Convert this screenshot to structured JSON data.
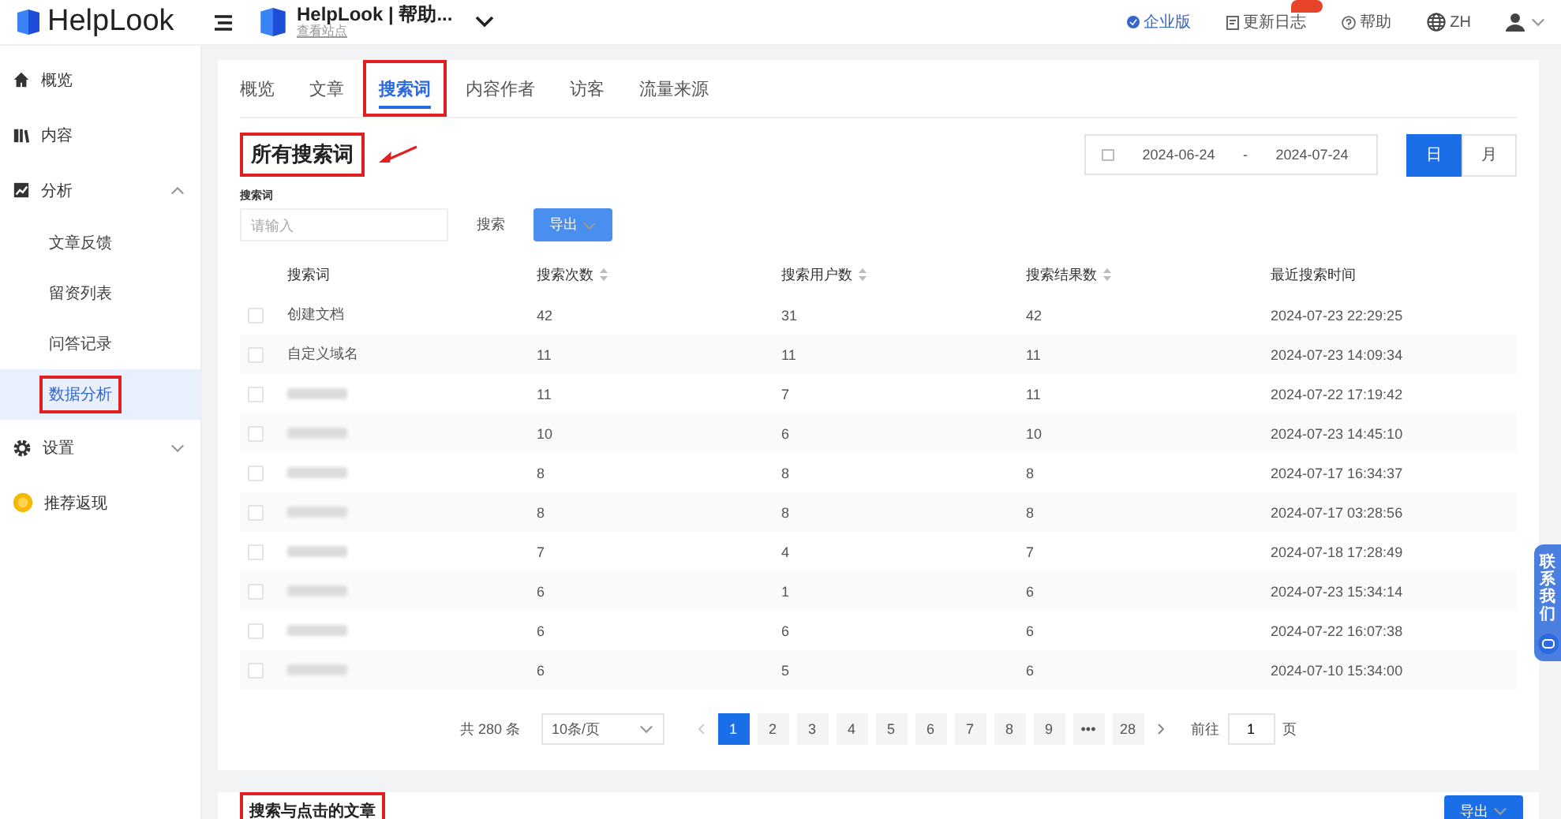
{
  "topbar": {
    "logo": "HelpLook",
    "site_title": "HelpLook | 帮助...",
    "site_link": "查看站点",
    "links": [
      {
        "kind": "plan",
        "label": "企业版"
      },
      {
        "kind": "changelog",
        "label": "更新日志",
        "badge": true
      },
      {
        "kind": "help",
        "label": "帮助"
      },
      {
        "kind": "language",
        "label": "ZH"
      }
    ]
  },
  "sidebar": {
    "items": [
      {
        "kind": "home",
        "label": "概览"
      },
      {
        "kind": "book",
        "label": "内容"
      },
      {
        "kind": "chart",
        "label": "分析",
        "expanded": true,
        "children": [
          {
            "label": "文章反馈",
            "selected": false,
            "highlighted": false
          },
          {
            "label": "留资列表",
            "selected": false,
            "highlighted": false
          },
          {
            "label": "问答记录",
            "selected": false,
            "highlighted": false
          },
          {
            "label": "数据分析",
            "selected": true,
            "highlighted": true
          }
        ]
      },
      {
        "kind": "gear",
        "label": "设置",
        "expanded": false
      },
      {
        "kind": "coin",
        "label": "推荐返现"
      }
    ]
  },
  "tabs": [
    {
      "label": "概览",
      "selected": false,
      "highlighted": false
    },
    {
      "label": "文章",
      "selected": false,
      "highlighted": false
    },
    {
      "label": "搜索词",
      "selected": true,
      "highlighted": true
    },
    {
      "label": "内容作者",
      "selected": false,
      "highlighted": false
    },
    {
      "label": "访客",
      "selected": false,
      "highlighted": false
    },
    {
      "label": "流量来源",
      "selected": false,
      "highlighted": false
    }
  ],
  "search_terms": {
    "title": "所有搜索词",
    "highlighted": true,
    "annotation_arrow": true,
    "date_range": {
      "start": "2024-06-24",
      "separator": "-",
      "end": "2024-07-24"
    },
    "granularity": [
      {
        "label": "日",
        "selected": true
      },
      {
        "label": "月",
        "selected": false
      }
    ],
    "filter": {
      "label": "搜索词",
      "placeholder": "请输入",
      "search_button": "搜索",
      "export_button": "导出"
    },
    "table": {
      "columns": [
        {
          "label": "搜索词",
          "sortable": false
        },
        {
          "label": "搜索次数",
          "sortable": true
        },
        {
          "label": "搜索用户数",
          "sortable": true
        },
        {
          "label": "搜索结果数",
          "sortable": true
        },
        {
          "label": "最近搜索时间",
          "sortable": false
        }
      ],
      "rows": [
        {
          "checked": false,
          "term": {
            "kind": "text",
            "text": "创建文档"
          },
          "count": "42",
          "users": "31",
          "results": "42",
          "last": "2024-07-23 22:29:25"
        },
        {
          "checked": false,
          "term": {
            "kind": "text",
            "text": "自定义域名"
          },
          "count": "11",
          "users": "11",
          "results": "11",
          "last": "2024-07-23 14:09:34"
        },
        {
          "checked": false,
          "term": {
            "kind": "redacted"
          },
          "count": "11",
          "users": "7",
          "results": "11",
          "last": "2024-07-22 17:19:42"
        },
        {
          "checked": false,
          "term": {
            "kind": "redacted"
          },
          "count": "10",
          "users": "6",
          "results": "10",
          "last": "2024-07-23 14:45:10"
        },
        {
          "checked": false,
          "term": {
            "kind": "redacted"
          },
          "count": "8",
          "users": "8",
          "results": "8",
          "last": "2024-07-17 16:34:37"
        },
        {
          "checked": false,
          "term": {
            "kind": "redacted"
          },
          "count": "8",
          "users": "8",
          "results": "8",
          "last": "2024-07-17 03:28:56"
        },
        {
          "checked": false,
          "term": {
            "kind": "redacted"
          },
          "count": "7",
          "users": "4",
          "results": "7",
          "last": "2024-07-18 17:28:49"
        },
        {
          "checked": false,
          "term": {
            "kind": "redacted"
          },
          "count": "6",
          "users": "1",
          "results": "6",
          "last": "2024-07-23 15:34:14"
        },
        {
          "checked": false,
          "term": {
            "kind": "redacted"
          },
          "count": "6",
          "users": "6",
          "results": "6",
          "last": "2024-07-22 16:07:38"
        },
        {
          "checked": false,
          "term": {
            "kind": "redacted"
          },
          "count": "6",
          "users": "5",
          "results": "6",
          "last": "2024-07-10 15:34:00"
        }
      ]
    },
    "pagination": {
      "total": "共 280 条",
      "page_size": "10条/页",
      "pages": [
        {
          "label": "1",
          "selected": true
        },
        {
          "label": "2",
          "selected": false
        },
        {
          "label": "3",
          "selected": false
        },
        {
          "label": "4",
          "selected": false
        },
        {
          "label": "5",
          "selected": false
        },
        {
          "label": "6",
          "selected": false
        },
        {
          "label": "7",
          "selected": false
        },
        {
          "label": "8",
          "selected": false
        },
        {
          "label": "9",
          "selected": false
        },
        {
          "label": "•••",
          "selected": false
        },
        {
          "label": "28",
          "selected": false
        }
      ],
      "goto_label": "前往",
      "goto_value": "1",
      "goto_unit": "页"
    }
  },
  "articles": {
    "title": "搜索与点击的文章",
    "highlighted": true,
    "export_button": "导出"
  },
  "contact": {
    "label": "联系我们"
  }
}
